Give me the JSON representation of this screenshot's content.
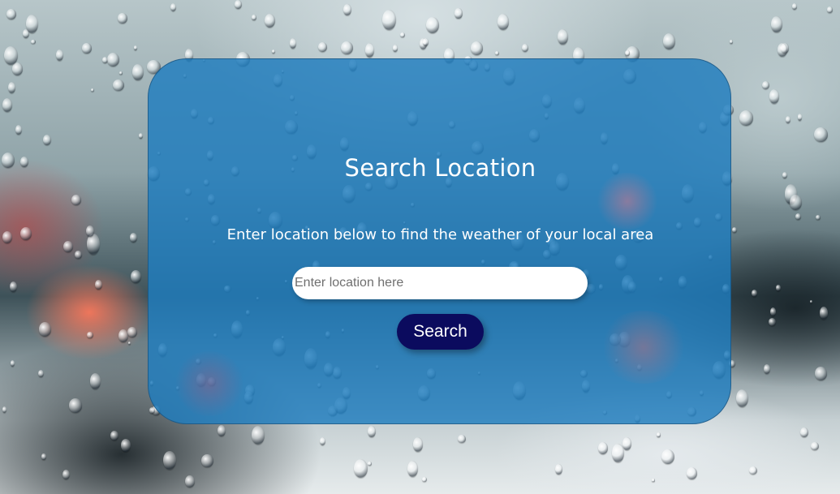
{
  "search_card": {
    "title": "Search Location",
    "subtitle": "Enter location below to find the weather of your local area",
    "input": {
      "placeholder": "Enter location here",
      "value": ""
    },
    "search_button_label": "Search"
  },
  "colors": {
    "card_background": "#1e7dbe",
    "button_background": "#0b0b5e",
    "text": "#ffffff",
    "input_background": "#ffffff"
  }
}
